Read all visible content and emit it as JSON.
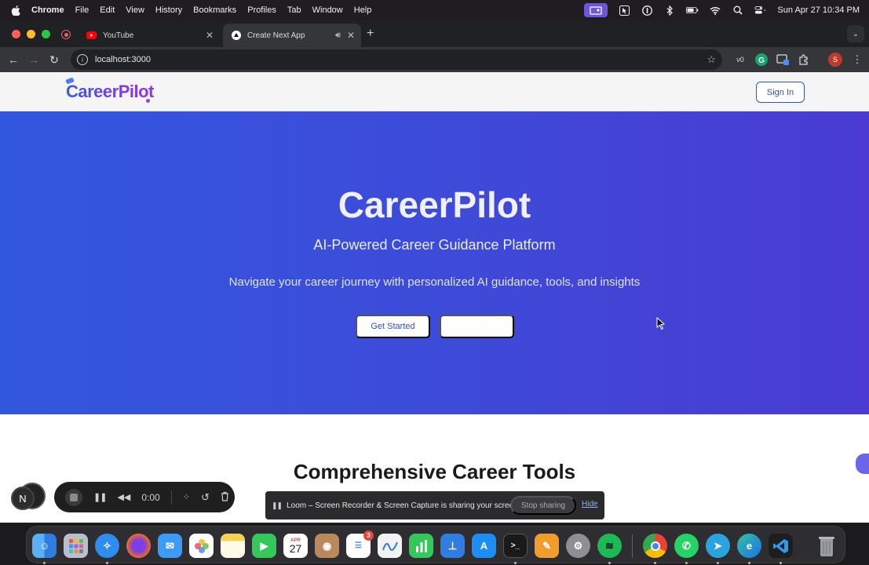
{
  "menubar": {
    "app": "Chrome",
    "items": [
      "File",
      "Edit",
      "View",
      "History",
      "Bookmarks",
      "Profiles",
      "Tab",
      "Window",
      "Help"
    ],
    "clock": "Sun Apr 27  10:34 PM"
  },
  "tabs": [
    {
      "title": "YouTube",
      "icon": "youtube-icon",
      "active": false
    },
    {
      "title": "Create Next App",
      "icon": "nextjs-icon",
      "active": true
    }
  ],
  "toolbar": {
    "url": "localhost:3000",
    "profile_initial": "S"
  },
  "site": {
    "logo": "CareerPilot",
    "signin_label": "Sign In"
  },
  "hero": {
    "title": "CareerPilot",
    "subtitle": "AI-Powered Career Guidance Platform",
    "description": "Navigate your career journey with personalized AI guidance, tools, and insights",
    "primary_cta": "Get Started"
  },
  "section": {
    "title": "Comprehensive Career Tools"
  },
  "loom": {
    "avatar_initial": "N",
    "timer": "0:00",
    "share_message": "Loom – Screen Recorder & Screen Capture is sharing your screen.",
    "stop_label": "Stop sharing",
    "hide_label": "Hide"
  },
  "dock": {
    "calendar_month": "APR",
    "calendar_day": "27",
    "reminders_badge": "3"
  },
  "colors": {
    "hero_start": "#3257df",
    "hero_end": "#4a3bd2",
    "brand_blue": "#3151c7",
    "brand_purple": "#7c3aed"
  }
}
